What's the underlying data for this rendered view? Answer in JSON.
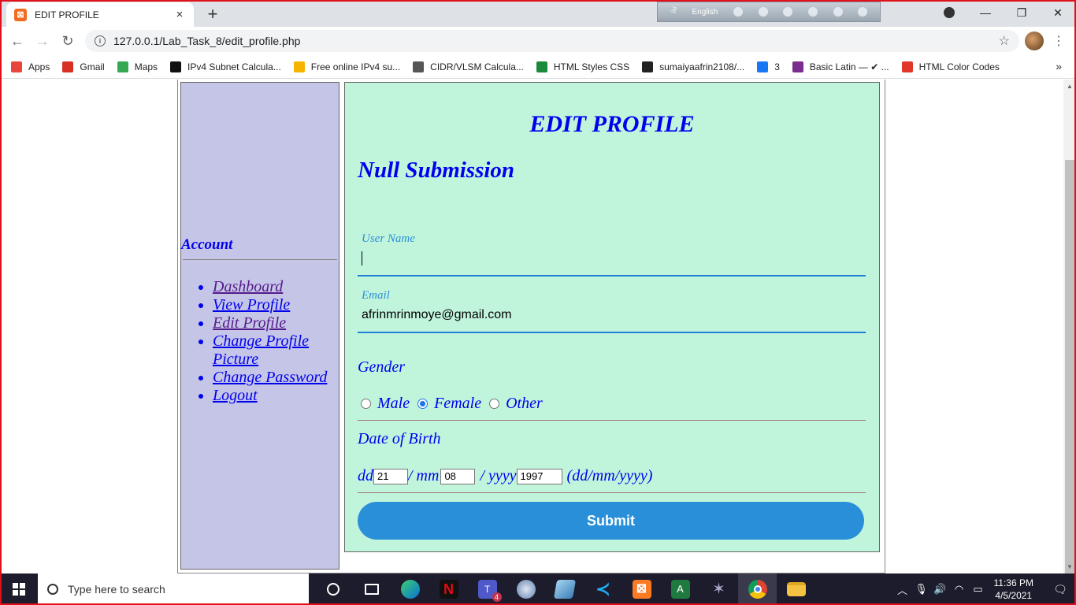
{
  "browser": {
    "tab_title": "EDIT PROFILE",
    "tab_close": "×",
    "new_tab": "+",
    "ime_language": "English",
    "url": "127.0.0.1/Lab_Task_8/edit_profile.php"
  },
  "bookmarks": [
    {
      "label": "Apps",
      "icon": "apps-grid-icon",
      "color": "#e8453c"
    },
    {
      "label": "Gmail",
      "icon": "gmail-icon",
      "color": "#d93025"
    },
    {
      "label": "Maps",
      "icon": "maps-icon",
      "color": "#34a853"
    },
    {
      "label": "IPv4 Subnet Calcula...",
      "icon": "notion-icon",
      "color": "#111111"
    },
    {
      "label": "Free online IPv4 su...",
      "icon": "amazon-a-icon",
      "color": "#f5b400"
    },
    {
      "label": "CIDR/VLSM Calcula...",
      "icon": "globe-icon",
      "color": "#555555"
    },
    {
      "label": "HTML Styles CSS",
      "icon": "w3schools-icon",
      "color": "#1a8a3a"
    },
    {
      "label": "sumaiyaafrin2108/...",
      "icon": "github-icon",
      "color": "#222222"
    },
    {
      "label": "3",
      "icon": "facebook-icon",
      "color": "#1877f2"
    },
    {
      "label": "Basic Latin — ✔ ...",
      "icon": "unicode-table-icon",
      "color": "#7b2c8f"
    },
    {
      "label": "HTML Color Codes",
      "icon": "color-codes-icon",
      "color": "#e0362c"
    }
  ],
  "bookmarks_more": "»",
  "sidebar": {
    "heading": "Account",
    "links": [
      {
        "label": "Dashboard",
        "visited": true
      },
      {
        "label": "View Profile",
        "visited": false
      },
      {
        "label": "Edit Profile",
        "visited": true
      },
      {
        "label": "Change Profile Picture",
        "visited": false
      },
      {
        "label": "Change Password",
        "visited": false
      },
      {
        "label": "Logout",
        "visited": false
      }
    ]
  },
  "form": {
    "title": "EDIT PROFILE",
    "message": "Null Submission",
    "username_label": "User Name",
    "username_value": "",
    "email_label": "Email",
    "email_value": "afrinmrinmoye@gmail.com",
    "gender_label": "Gender",
    "gender_options": [
      "Male",
      "Female",
      "Other"
    ],
    "gender_selected": "Female",
    "dob_label": "Date of Birth",
    "dd_label": "dd",
    "mm_label": "/ mm",
    "yyyy_label": "/ yyyy",
    "dd_value": "21",
    "mm_value": "08",
    "yyyy_value": "1997",
    "dob_format": "(dd/mm/yyyy)",
    "submit_label": "Submit"
  },
  "taskbar": {
    "search_placeholder": "Type here to search",
    "time": "11:36 PM",
    "date": "4/5/2021",
    "teams_badge": "4"
  },
  "colors": {
    "link": "#0000ee",
    "visited": "#551a8b",
    "sidebar_bg": "#c5c5e8",
    "main_bg": "#c0f5dc",
    "submit_bg": "#2a8fd9"
  }
}
